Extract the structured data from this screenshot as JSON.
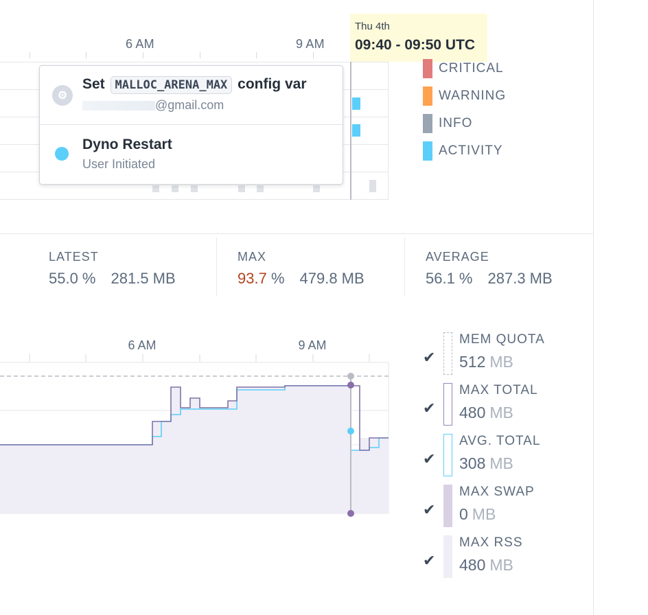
{
  "events_chart": {
    "axis_labels": [
      "6 AM",
      "9 AM"
    ],
    "tooltip": {
      "day": "Thu 4th",
      "range": "09:40 - 09:50 UTC"
    },
    "popover": {
      "item1": {
        "title_prefix": "Set",
        "config_var": "MALLOC_ARENA_MAX",
        "title_suffix": "config var",
        "email_suffix": "@gmail.com"
      },
      "item2": {
        "title": "Dyno Restart",
        "subtitle": "User Initiated"
      }
    },
    "legend": [
      {
        "label": "CRITICAL",
        "color": "#e27b7b"
      },
      {
        "label": "WARNING",
        "color": "#ffa24f"
      },
      {
        "label": "INFO",
        "color": "#9aa5b3"
      },
      {
        "label": "ACTIVITY",
        "color": "#5ccefa"
      }
    ]
  },
  "stats": {
    "latest": {
      "label": "LATEST",
      "percent": "55.0 %",
      "mb": "281.5 MB"
    },
    "max": {
      "label": "MAX",
      "percent_num": "93.7",
      "percent_unit": " %",
      "mb": "479.8 MB"
    },
    "average": {
      "label": "AVERAGE",
      "percent": "56.1 %",
      "mb": "287.3 MB"
    }
  },
  "memory_chart": {
    "axis_labels": [
      "6 AM",
      "9 AM"
    ],
    "legend": [
      {
        "name": "MEM QUOTA",
        "value": "512",
        "unit": "MB",
        "style": "dashed",
        "color": "#b9bcc4",
        "checked": true
      },
      {
        "name": "MAX TOTAL",
        "value": "480",
        "unit": "MB",
        "style": "outline",
        "color": "#9a83b4",
        "checked": true
      },
      {
        "name": "AVG. TOTAL",
        "value": "308",
        "unit": "MB",
        "style": "outline",
        "color": "#5ccefa",
        "checked": true
      },
      {
        "name": "MAX SWAP",
        "value": "0",
        "unit": "MB",
        "style": "fill",
        "color": "#d9d0e4",
        "checked": true
      },
      {
        "name": "MAX RSS",
        "value": "480",
        "unit": "MB",
        "style": "fill",
        "color": "#efedf5",
        "checked": true
      }
    ],
    "check_icon": "check-icon"
  }
}
